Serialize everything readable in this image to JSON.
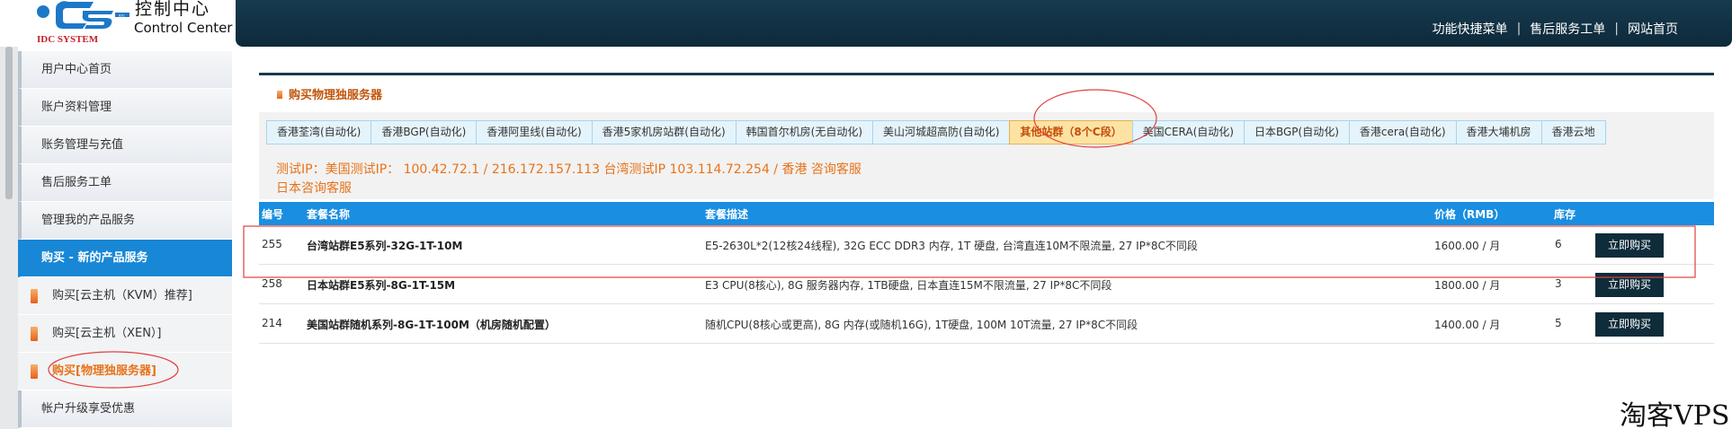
{
  "logo": {
    "title_cn": "控制中心",
    "title_en": "Control Center",
    "mark_text": "IDC SYSTEM",
    "mark_small": "IDC"
  },
  "header": {
    "links": [
      "功能快捷菜单",
      "售后服务工单",
      "网站首页"
    ],
    "separator": "|"
  },
  "sidebar": {
    "items": [
      {
        "label": "用户中心首页"
      },
      {
        "label": "账户资料管理"
      },
      {
        "label": "账务管理与充值"
      },
      {
        "label": "售后服务工单"
      },
      {
        "label": "管理我的产品服务"
      },
      {
        "label": "购买 - 新的产品服务"
      }
    ],
    "subitems": [
      {
        "label": "购买[云主机（KVM）推荐]"
      },
      {
        "label": "购买[云主机（XEN）]"
      },
      {
        "label": "购买[物理独服务器]"
      }
    ],
    "footer_item": "帐户升级享受优惠"
  },
  "panel": {
    "title": "购买物理独服务器",
    "tabs": [
      "香港荃湾(自动化)",
      "香港BGP(自动化)",
      "香港阿里线(自动化)",
      "香港5家机房站群(自动化)",
      "韩国首尔机房(无自动化)",
      "美山河城超高防(自动化)",
      "其他站群（8个C段）",
      "美国CERA(自动化)",
      "日本BGP(自动化)",
      "香港cera(自动化)",
      "香港大埔机房",
      "香港云地"
    ],
    "active_tab": "其他站群（8个C段）",
    "notice_line1": "测试IP：美国测试IP： 100.42.72.1 / 216.172.157.113 台湾测试IP 103.114.72.254 / 香港 咨询客服",
    "notice_line2": "日本咨询客服"
  },
  "table": {
    "headers": [
      "编号",
      "套餐名称",
      "套餐描述",
      "价格（RMB）",
      "库存"
    ],
    "buy_label": "立即购买",
    "rows": [
      {
        "id": "255",
        "name": "台湾站群E5系列-32G-1T-10M",
        "desc": "E5-2630L*2(12核24线程), 32G ECC DDR3 内存, 1T 硬盘, 台湾直连10M不限流量, 27 IP*8C不同段",
        "price": "1600.00 / 月",
        "stock": "6"
      },
      {
        "id": "258",
        "name": "日本站群E5系列-8G-1T-15M",
        "desc": "E3 CPU(8核心), 8G 服务器内存, 1TB硬盘, 日本直连15M不限流量, 27 IP*8C不同段",
        "price": "1800.00 / 月",
        "stock": "3"
      },
      {
        "id": "214",
        "name": "美国站群随机系列-8G-1T-100M（机房随机配置）",
        "desc": "随机CPU(8核心或更高), 8G 内存(或随机16G), 1T硬盘, 100M 10T流量, 27 IP*8C不同段",
        "price": "1400.00 / 月",
        "stock": "5"
      }
    ]
  },
  "watermark": "淘客VPS",
  "colors": {
    "header_bg": "#12344a",
    "accent_blue": "#1a8ee0",
    "accent_orange": "#e8731a",
    "button_dark": "#0f2c3b",
    "annotation_red": "#e04040"
  }
}
